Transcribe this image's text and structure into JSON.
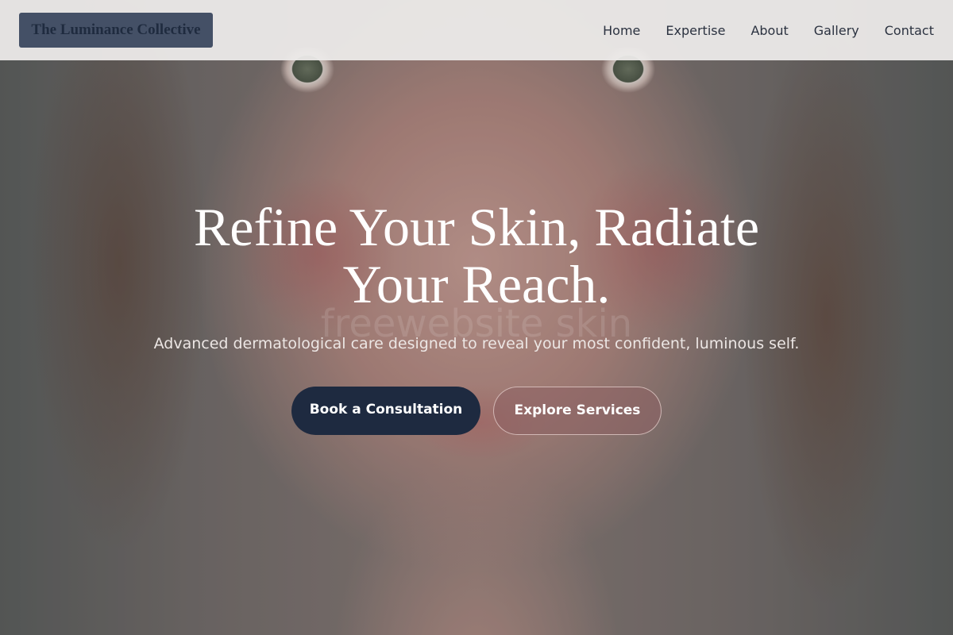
{
  "header": {
    "logo_text": "The Luminance Collective",
    "nav": [
      {
        "label": "Home"
      },
      {
        "label": "Expertise"
      },
      {
        "label": "About"
      },
      {
        "label": "Gallery"
      },
      {
        "label": "Contact"
      }
    ]
  },
  "hero": {
    "title_line1": "Refine Your Skin, Radiate",
    "title_line2": "Your Reach.",
    "watermark": "freewebsite skin",
    "subtitle": "Advanced dermatological care designed to reveal your most confident, luminous self.",
    "primary_cta": "Book a Consultation",
    "secondary_cta": "Explore Services"
  },
  "colors": {
    "header_bg": "#eceae9",
    "logo_bg": "#445066",
    "logo_text": "#1f2b3f",
    "primary_button": "#1e2a40",
    "nav_text": "#2b3240"
  }
}
